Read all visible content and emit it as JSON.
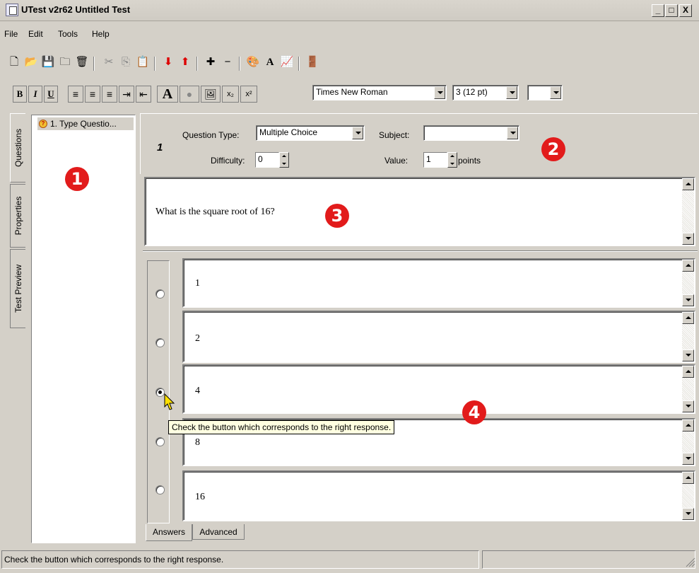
{
  "window": {
    "title": "UTest v2r62 Untitled Test",
    "controls": [
      "_",
      "□",
      "X"
    ]
  },
  "menu": [
    {
      "label": "File"
    },
    {
      "label": "Edit"
    },
    {
      "label": "Tools"
    },
    {
      "label": "Help"
    }
  ],
  "toolbar_icons": [
    "new-file-icon",
    "open-folder-icon",
    "save-icon",
    "folder-icon",
    "delete-icon",
    "cut-icon",
    "copy-icon",
    "paste-icon",
    "move-down-icon",
    "move-up-icon",
    "add-icon",
    "remove-icon",
    "color-palette-icon",
    "font-icon",
    "chart-icon",
    "exit-icon"
  ],
  "format_toolbar": {
    "bold": "B",
    "italic": "I",
    "underline": "U",
    "font_label": "A",
    "subscript": "x₂",
    "superscript": "x²",
    "font_name": "Times New Roman",
    "font_size": "3 (12 pt)",
    "color": ""
  },
  "side_tabs": [
    "Questions",
    "Properties",
    "Test Preview"
  ],
  "question_list": [
    {
      "label": "1. Type Questio..."
    }
  ],
  "question": {
    "number": "1",
    "type_label": "Question Type:",
    "type_value": "Multiple Choice",
    "subject_label": "Subject:",
    "subject_value": "",
    "difficulty_label": "Difficulty:",
    "difficulty_value": "0",
    "value_label": "Value:",
    "value_value": "1",
    "value_unit": "points",
    "text": "What is the square root of 16?"
  },
  "answers": [
    {
      "text": "1",
      "correct": false
    },
    {
      "text": "2",
      "correct": false
    },
    {
      "text": "4",
      "correct": true
    },
    {
      "text": "8",
      "correct": false
    },
    {
      "text": "16",
      "correct": false
    }
  ],
  "tooltip": "Check the button which corresponds to the right response.",
  "bottom_tabs": [
    "Answers",
    "Advanced"
  ],
  "status": "Check the button which corresponds to the right response.",
  "badges": [
    "1",
    "2",
    "3",
    "4"
  ],
  "colors": {
    "badge": "#e21b1b",
    "window_bg": "#d4d0c8",
    "tooltip_bg": "#ffffe1"
  }
}
